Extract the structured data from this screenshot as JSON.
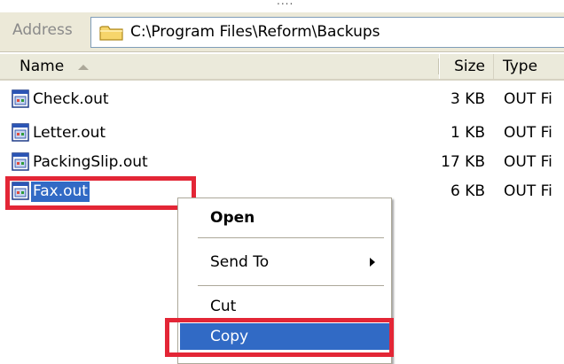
{
  "address": {
    "label": "Address",
    "path": "C:\\Program Files\\Reform\\Backups",
    "icon": "folder-icon"
  },
  "columns": {
    "name": "Name",
    "size": "Size",
    "type": "Type"
  },
  "files": [
    {
      "name": "Check.out",
      "size": "3 KB",
      "type": "OUT Fi",
      "icon": "out-file-icon"
    },
    {
      "name": "Letter.out",
      "size": "1 KB",
      "type": "OUT Fi",
      "icon": "out-file-icon"
    },
    {
      "name": "PackingSlip.out",
      "size": "17 KB",
      "type": "OUT Fi",
      "icon": "out-file-icon"
    },
    {
      "name": "Fax.out",
      "size": "6 KB",
      "type": "OUT Fi",
      "icon": "out-file-icon",
      "selected": true
    }
  ],
  "context_menu": {
    "open": "Open",
    "send_to": "Send To",
    "cut": "Cut",
    "copy": "Copy",
    "hovered_item": "Copy"
  },
  "colors": {
    "selection": "#316ac5",
    "highlight_box": "#e32636",
    "toolbar_bg": "#ece9d8"
  }
}
